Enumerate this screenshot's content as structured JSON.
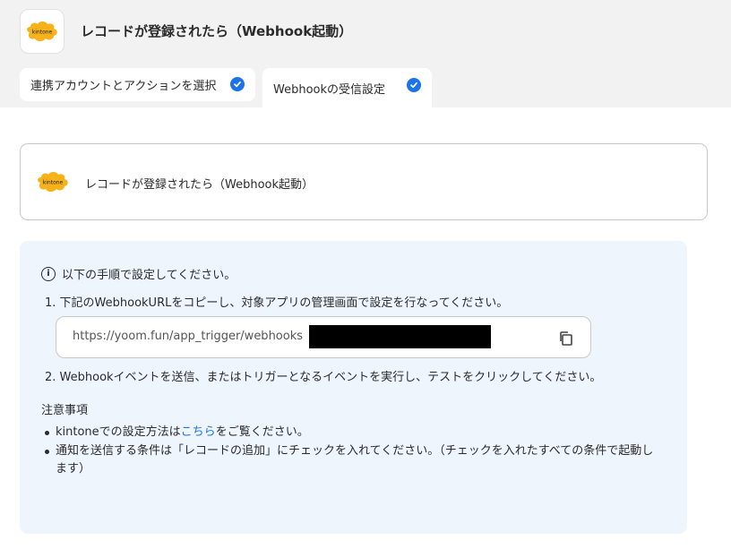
{
  "header": {
    "title": "レコードが登録されたら（Webhook起動）",
    "logo_text": "kintone",
    "logo_icon": "kintone-logo-icon"
  },
  "tabs": [
    {
      "label": "連携アカウントとアクションを選択",
      "completed": true
    },
    {
      "label": "Webhookの受信設定",
      "completed": true
    }
  ],
  "event_card": {
    "title": "レコードが登録されたら（Webhook起動）",
    "logo_text": "kintone"
  },
  "info": {
    "intro": "以下の手順で設定してください。",
    "step1": "1. 下記のWebhookURLをコピーし、対象アプリの管理画面で設定を行なってください。",
    "webhook_url": "https://yoom.fun/app_trigger/webhooks",
    "step2": "2. Webhookイベントを送信、またはトリガーとなるイベントを実行し、テストをクリックしてください。",
    "notes_heading": "注意事項",
    "note1_pre": "kintoneでの設定方法は",
    "note1_link": "こちら",
    "note1_post": "をご覧ください。",
    "note2": "通知を送信する条件は「レコードの追加」にチェックを入れてください。（チェックを入れたすべての条件で起動します）"
  },
  "colors": {
    "accent": "#1a73e8",
    "kintone_yellow": "#f6b21b",
    "panel_bg": "#eef5fd",
    "top_band": "#f2f2f2"
  }
}
